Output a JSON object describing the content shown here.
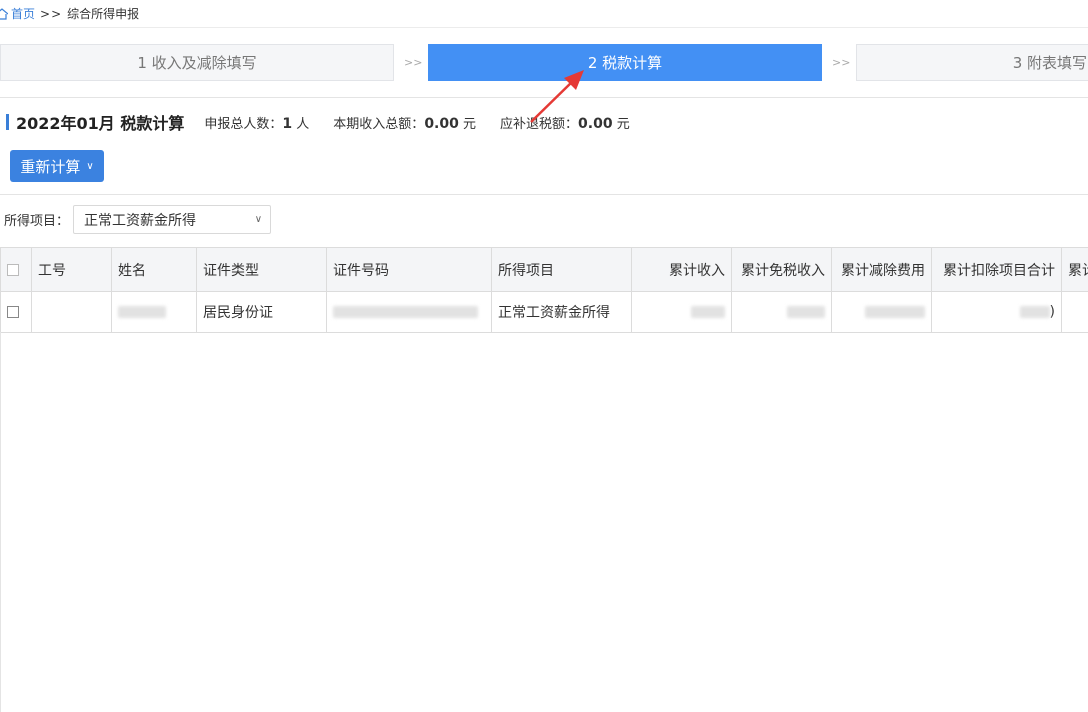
{
  "breadcrumb": {
    "home_label": "首页",
    "separator": ">>",
    "current": "综合所得申报"
  },
  "steps": [
    {
      "label": "1 收入及减除填写",
      "active": false
    },
    {
      "label": "2 税款计算",
      "active": true
    },
    {
      "label": "3 附表填写",
      "active": false
    }
  ],
  "step_separator": ">>",
  "summary": {
    "title": "2022年01月 税款计算",
    "count_label": "申报总人数：",
    "count_value": "1",
    "count_unit": "人",
    "income_label": "本期收入总额：",
    "income_value": "0.00",
    "income_unit": "元",
    "tax_label": "应补退税额：",
    "tax_value": "0.00",
    "tax_unit": "元"
  },
  "recalc_button": {
    "label": "重新计算",
    "icon": "chevron-down-icon"
  },
  "filter": {
    "label": "所得项目：",
    "selected": "正常工资薪金所得",
    "icon": "chevron-down-icon"
  },
  "table": {
    "columns": [
      "",
      "工号",
      "姓名",
      "证件类型",
      "证件号码",
      "所得项目",
      "累计收入",
      "累计免税收入",
      "累计减除费用",
      "累计扣除项目合计",
      "累计"
    ],
    "rows": [
      {
        "employee_id": "",
        "id_type": "居民身份证",
        "income_item": "正常工资薪金所得",
        "deduction_total_suffix": ")"
      }
    ]
  },
  "colors": {
    "accent": "#3a7fd8",
    "active_step": "#4390f4",
    "arrow": "#e53935"
  }
}
